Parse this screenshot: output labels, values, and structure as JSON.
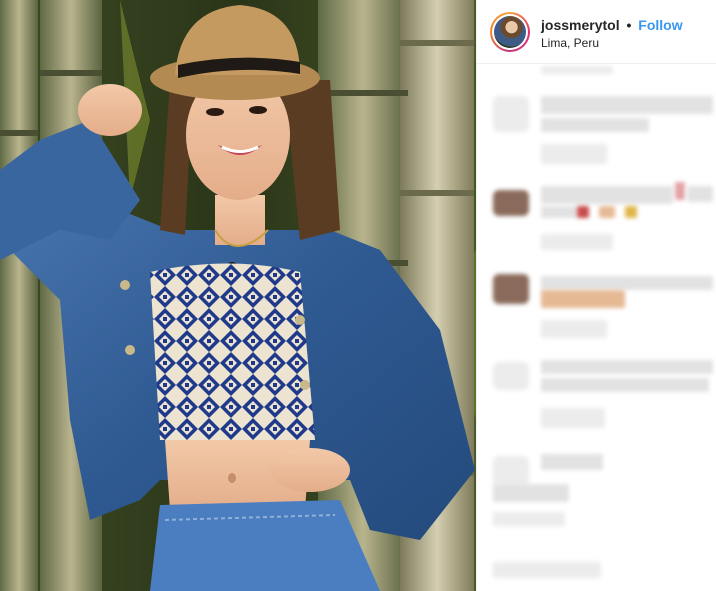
{
  "post": {
    "image_alt": "",
    "username": "jossmerytol",
    "separator": "•",
    "follow_label": "Follow",
    "location": "Lima, Peru"
  },
  "colors": {
    "follow_blue": "#3897f0",
    "text": "#262626",
    "divider": "#efefef"
  },
  "icons": {
    "avatar": "user-avatar"
  }
}
